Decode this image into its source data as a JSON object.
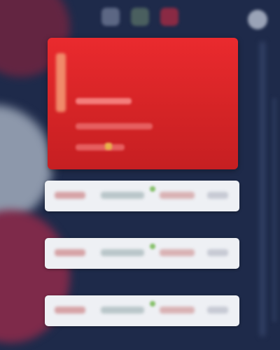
{
  "colors": {
    "background": "#1e2a4a",
    "hero": "#d52426",
    "row": "#eef0f4",
    "accent_maroon": "#7e2a4a"
  },
  "topbar": {
    "icons": [
      "app-icon",
      "app-icon",
      "app-icon"
    ],
    "corner_icon": "circle-icon"
  },
  "hero": {
    "text": ""
  },
  "rows": [
    {
      "label": ""
    },
    {
      "label": ""
    },
    {
      "label": ""
    }
  ]
}
